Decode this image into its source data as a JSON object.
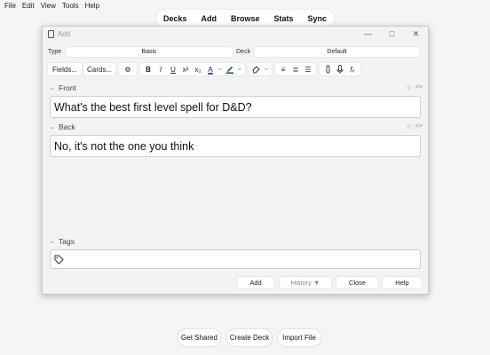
{
  "menu": [
    "File",
    "Edit",
    "View",
    "Tools",
    "Help"
  ],
  "toolbar": [
    "Decks",
    "Add",
    "Browse",
    "Stats",
    "Sync"
  ],
  "dialog": {
    "title": "Add",
    "type_label": "Type",
    "type_value": "Basic",
    "deck_label": "Deck",
    "deck_value": "Default",
    "fields_button": "Fields...",
    "cards_button": "Cards...",
    "front_label": "Front",
    "front_value": "What's the best first level spell for D&D?",
    "back_label": "Back",
    "back_value": "No, it's not the one you think",
    "tags_label": "Tags",
    "add_button": "Add",
    "history_button": "History ▼",
    "close_button": "Close",
    "help_button": "Help"
  },
  "main": {
    "get_shared": "Get Shared",
    "create_deck": "Create Deck",
    "import_file": "Import File"
  },
  "colors": {
    "text_color_swatch": "#3b3bd6",
    "highlight_swatch": "#1a3e8c"
  }
}
